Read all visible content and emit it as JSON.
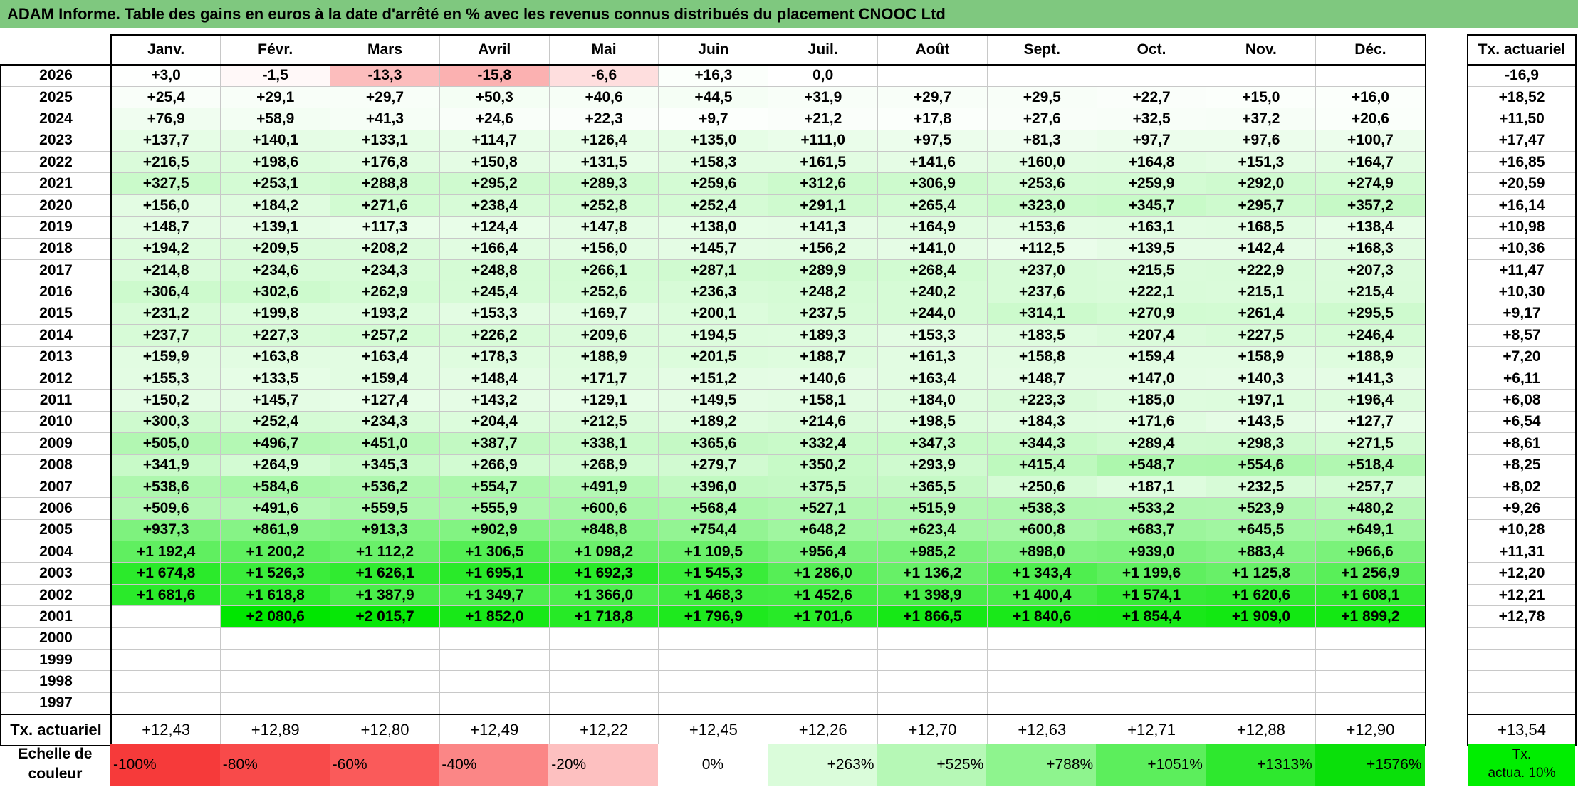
{
  "title": "ADAM Informe. Table des gains en euros à la date d'arrêté en % avec les revenus connus distribués du placement CNOOC Ltd",
  "months": [
    "Janv.",
    "Févr.",
    "Mars",
    "Avril",
    "Mai",
    "Juin",
    "Juil.",
    "Août",
    "Sept.",
    "Oct.",
    "Nov.",
    "Déc."
  ],
  "rate_header": "Tx. actuariel",
  "rows": [
    {
      "year": "2026",
      "values": [
        "+3,0",
        "-1,5",
        "-13,3",
        "-15,8",
        "-6,6",
        "+16,3",
        "0,0",
        "",
        "",
        "",
        "",
        ""
      ],
      "rate": "-16,9"
    },
    {
      "year": "2025",
      "values": [
        "+25,4",
        "+29,1",
        "+29,7",
        "+50,3",
        "+40,6",
        "+44,5",
        "+31,9",
        "+29,7",
        "+29,5",
        "+22,7",
        "+15,0",
        "+16,0"
      ],
      "rate": "+18,52"
    },
    {
      "year": "2024",
      "values": [
        "+76,9",
        "+58,9",
        "+41,3",
        "+24,6",
        "+22,3",
        "+9,7",
        "+21,2",
        "+17,8",
        "+27,6",
        "+32,5",
        "+37,2",
        "+20,6"
      ],
      "rate": "+11,50"
    },
    {
      "year": "2023",
      "values": [
        "+137,7",
        "+140,1",
        "+133,1",
        "+114,7",
        "+126,4",
        "+135,0",
        "+111,0",
        "+97,5",
        "+81,3",
        "+97,7",
        "+97,6",
        "+100,7"
      ],
      "rate": "+17,47"
    },
    {
      "year": "2022",
      "values": [
        "+216,5",
        "+198,6",
        "+176,8",
        "+150,8",
        "+131,5",
        "+158,3",
        "+161,5",
        "+141,6",
        "+160,0",
        "+164,8",
        "+151,3",
        "+164,7"
      ],
      "rate": "+16,85"
    },
    {
      "year": "2021",
      "values": [
        "+327,5",
        "+253,1",
        "+288,8",
        "+295,2",
        "+289,3",
        "+259,6",
        "+312,6",
        "+306,9",
        "+253,6",
        "+259,9",
        "+292,0",
        "+274,9"
      ],
      "rate": "+20,59"
    },
    {
      "year": "2020",
      "values": [
        "+156,0",
        "+184,2",
        "+271,6",
        "+238,4",
        "+252,8",
        "+252,4",
        "+291,1",
        "+265,4",
        "+323,0",
        "+345,7",
        "+295,7",
        "+357,2"
      ],
      "rate": "+16,14"
    },
    {
      "year": "2019",
      "values": [
        "+148,7",
        "+139,1",
        "+117,3",
        "+124,4",
        "+147,8",
        "+138,0",
        "+141,3",
        "+164,9",
        "+153,6",
        "+163,1",
        "+168,5",
        "+138,4"
      ],
      "rate": "+10,98"
    },
    {
      "year": "2018",
      "values": [
        "+194,2",
        "+209,5",
        "+208,2",
        "+166,4",
        "+156,0",
        "+145,7",
        "+156,2",
        "+141,0",
        "+112,5",
        "+139,5",
        "+142,4",
        "+168,3"
      ],
      "rate": "+10,36"
    },
    {
      "year": "2017",
      "values": [
        "+214,8",
        "+234,6",
        "+234,3",
        "+248,8",
        "+266,1",
        "+287,1",
        "+289,9",
        "+268,4",
        "+237,0",
        "+215,5",
        "+222,9",
        "+207,3"
      ],
      "rate": "+11,47"
    },
    {
      "year": "2016",
      "values": [
        "+306,4",
        "+302,6",
        "+262,9",
        "+245,4",
        "+252,6",
        "+236,3",
        "+248,2",
        "+240,2",
        "+237,6",
        "+222,1",
        "+215,1",
        "+215,4"
      ],
      "rate": "+10,30"
    },
    {
      "year": "2015",
      "values": [
        "+231,2",
        "+199,8",
        "+193,2",
        "+153,3",
        "+169,7",
        "+200,1",
        "+237,5",
        "+244,0",
        "+314,1",
        "+270,9",
        "+261,4",
        "+295,5"
      ],
      "rate": "+9,17"
    },
    {
      "year": "2014",
      "values": [
        "+237,7",
        "+227,3",
        "+257,2",
        "+226,2",
        "+209,6",
        "+194,5",
        "+189,3",
        "+153,3",
        "+183,5",
        "+207,4",
        "+227,5",
        "+246,4"
      ],
      "rate": "+8,57"
    },
    {
      "year": "2013",
      "values": [
        "+159,9",
        "+163,8",
        "+163,4",
        "+178,3",
        "+188,9",
        "+201,5",
        "+188,7",
        "+161,3",
        "+158,8",
        "+159,4",
        "+158,9",
        "+188,9"
      ],
      "rate": "+7,20"
    },
    {
      "year": "2012",
      "values": [
        "+155,3",
        "+133,5",
        "+159,4",
        "+148,4",
        "+171,7",
        "+151,2",
        "+140,6",
        "+163,4",
        "+148,7",
        "+147,0",
        "+140,3",
        "+141,3"
      ],
      "rate": "+6,11"
    },
    {
      "year": "2011",
      "values": [
        "+150,2",
        "+145,7",
        "+127,4",
        "+143,2",
        "+129,1",
        "+149,5",
        "+158,1",
        "+184,0",
        "+223,3",
        "+185,0",
        "+197,1",
        "+196,4"
      ],
      "rate": "+6,08"
    },
    {
      "year": "2010",
      "values": [
        "+300,3",
        "+252,4",
        "+234,3",
        "+204,4",
        "+212,5",
        "+189,2",
        "+214,6",
        "+198,5",
        "+184,3",
        "+171,6",
        "+143,5",
        "+127,7"
      ],
      "rate": "+6,54"
    },
    {
      "year": "2009",
      "values": [
        "+505,0",
        "+496,7",
        "+451,0",
        "+387,7",
        "+338,1",
        "+365,6",
        "+332,4",
        "+347,3",
        "+344,3",
        "+289,4",
        "+298,3",
        "+271,5"
      ],
      "rate": "+8,61"
    },
    {
      "year": "2008",
      "values": [
        "+341,9",
        "+264,9",
        "+345,3",
        "+266,9",
        "+268,9",
        "+279,7",
        "+350,2",
        "+293,9",
        "+415,4",
        "+548,7",
        "+554,6",
        "+518,4"
      ],
      "rate": "+8,25"
    },
    {
      "year": "2007",
      "values": [
        "+538,6",
        "+584,6",
        "+536,2",
        "+554,7",
        "+491,9",
        "+396,0",
        "+375,5",
        "+365,5",
        "+250,6",
        "+187,1",
        "+232,5",
        "+257,7"
      ],
      "rate": "+8,02"
    },
    {
      "year": "2006",
      "values": [
        "+509,6",
        "+491,6",
        "+559,5",
        "+555,9",
        "+600,6",
        "+568,4",
        "+527,1",
        "+515,9",
        "+538,3",
        "+533,2",
        "+523,9",
        "+480,2"
      ],
      "rate": "+9,26"
    },
    {
      "year": "2005",
      "values": [
        "+937,3",
        "+861,9",
        "+913,3",
        "+902,9",
        "+848,8",
        "+754,4",
        "+648,2",
        "+623,4",
        "+600,8",
        "+683,7",
        "+645,5",
        "+649,1"
      ],
      "rate": "+10,28"
    },
    {
      "year": "2004",
      "values": [
        "+1 192,4",
        "+1 200,2",
        "+1 112,2",
        "+1 306,5",
        "+1 098,2",
        "+1 109,5",
        "+956,4",
        "+985,2",
        "+898,0",
        "+939,0",
        "+883,4",
        "+966,6"
      ],
      "rate": "+11,31"
    },
    {
      "year": "2003",
      "values": [
        "+1 674,8",
        "+1 526,3",
        "+1 626,1",
        "+1 695,1",
        "+1 692,3",
        "+1 545,3",
        "+1 286,0",
        "+1 136,2",
        "+1 343,4",
        "+1 199,6",
        "+1 125,8",
        "+1 256,9"
      ],
      "rate": "+12,20"
    },
    {
      "year": "2002",
      "values": [
        "+1 681,6",
        "+1 618,8",
        "+1 387,9",
        "+1 349,7",
        "+1 366,0",
        "+1 468,3",
        "+1 452,6",
        "+1 398,9",
        "+1 400,4",
        "+1 574,1",
        "+1 620,6",
        "+1 608,1"
      ],
      "rate": "+12,21"
    },
    {
      "year": "2001",
      "values": [
        "",
        "+2 080,6",
        "+2 015,7",
        "+1 852,0",
        "+1 718,8",
        "+1 796,9",
        "+1 701,6",
        "+1 866,5",
        "+1 840,6",
        "+1 854,4",
        "+1 909,0",
        "+1 899,2"
      ],
      "rate": "+12,78"
    },
    {
      "year": "2000",
      "values": [
        "",
        "",
        "",
        "",
        "",
        "",
        "",
        "",
        "",
        "",
        "",
        ""
      ],
      "rate": ""
    },
    {
      "year": "1999",
      "values": [
        "",
        "",
        "",
        "",
        "",
        "",
        "",
        "",
        "",
        "",
        "",
        ""
      ],
      "rate": ""
    },
    {
      "year": "1998",
      "values": [
        "",
        "",
        "",
        "",
        "",
        "",
        "",
        "",
        "",
        "",
        "",
        ""
      ],
      "rate": ""
    },
    {
      "year": "1997",
      "values": [
        "",
        "",
        "",
        "",
        "",
        "",
        "",
        "",
        "",
        "",
        "",
        ""
      ],
      "rate": ""
    }
  ],
  "footer": {
    "label": "Tx. actuariel",
    "values": [
      "+12,43",
      "+12,89",
      "+12,80",
      "+12,49",
      "+12,22",
      "+12,45",
      "+12,26",
      "+12,70",
      "+12,63",
      "+12,71",
      "+12,88",
      "+12,90"
    ],
    "rate": "+13,54"
  },
  "scale": {
    "label_line1": "Echelle de",
    "label_line2": "couleur",
    "items": [
      {
        "text": "-100%",
        "color": "#f63a3a",
        "kind": "neg"
      },
      {
        "text": "-80%",
        "color": "#f84a4a",
        "kind": "neg"
      },
      {
        "text": "-60%",
        "color": "#fa5a5a",
        "kind": "neg"
      },
      {
        "text": "-40%",
        "color": "#fb8686",
        "kind": "neg"
      },
      {
        "text": "-20%",
        "color": "#fdc0c0",
        "kind": "neg"
      },
      {
        "text": "0%",
        "color": "#ffffff",
        "kind": "zero"
      },
      {
        "text": "+263%",
        "color": "#dafcda",
        "kind": "pos"
      },
      {
        "text": "+525%",
        "color": "#b6f8b6",
        "kind": "pos"
      },
      {
        "text": "+788%",
        "color": "#8ef48e",
        "kind": "pos"
      },
      {
        "text": "+1051%",
        "color": "#5cee5c",
        "kind": "pos"
      },
      {
        "text": "+1313%",
        "color": "#2ee82e",
        "kind": "pos"
      },
      {
        "text": "+1576%",
        "color": "#0ae00a",
        "kind": "pos"
      }
    ],
    "ref_line1": "Tx.",
    "ref_line2": "actua. 10%",
    "ref_color": "#00ee00"
  },
  "colors": {
    "title_bg": "#7fc87f",
    "max_green": "#00e600",
    "max_red": "#f63a3a"
  }
}
